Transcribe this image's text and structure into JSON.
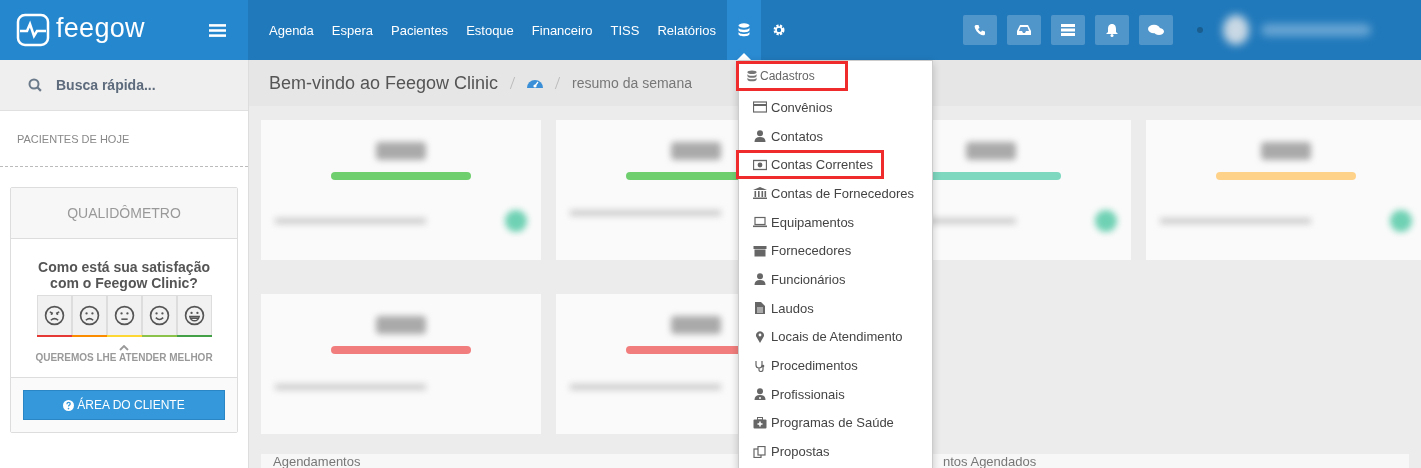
{
  "brand": {
    "name": "feegow"
  },
  "nav": [
    {
      "label": "Agenda"
    },
    {
      "label": "Espera"
    },
    {
      "label": "Pacientes"
    },
    {
      "label": "Estoque"
    },
    {
      "label": "Financeiro"
    },
    {
      "label": "TISS"
    },
    {
      "label": "Relatórios"
    }
  ],
  "sidebar": {
    "search": {
      "placeholder": "Busca rápida..."
    },
    "section": "PACIENTES DE HOJE",
    "survey": {
      "title": "QUALIDÔMETRO",
      "question": "Como está sua satisfação com o Feegow Clinic?",
      "hint": "QUEREMOS LHE ATENDER MELHOR",
      "faces": [
        {
          "kind": "angry",
          "color": "#e53935"
        },
        {
          "kind": "sad",
          "color": "#fb8c00"
        },
        {
          "kind": "neutral",
          "color": "#fdd835"
        },
        {
          "kind": "happy",
          "color": "#8bc34a"
        },
        {
          "kind": "grin",
          "color": "#43a047"
        }
      ],
      "button": "ÁREA DO CLIENTE"
    }
  },
  "breadcrumb": {
    "title": "Bem-vindo ao Feegow Clinic",
    "current": "resumo da semana"
  },
  "cards": [
    {
      "color": "#6fcf6f"
    },
    {
      "color": "#6fcf6f"
    },
    {
      "color": "#7ed8c0"
    },
    {
      "color": "#ffd28a"
    },
    {
      "color": "#f27d7d"
    },
    {
      "color": "#f27d7d"
    }
  ],
  "panels": [
    "Agendamentos",
    "ntos Agendados"
  ],
  "menu": {
    "header": {
      "label": "Cadastros",
      "highlighted": true
    },
    "items": [
      {
        "label": "Convênios",
        "highlighted": false
      },
      {
        "label": "Contatos",
        "highlighted": false
      },
      {
        "label": "Contas Correntes",
        "highlighted": true
      },
      {
        "label": "Contas de Fornecedores",
        "highlighted": false
      },
      {
        "label": "Equipamentos",
        "highlighted": false
      },
      {
        "label": "Fornecedores",
        "highlighted": false
      },
      {
        "label": "Funcionários",
        "highlighted": false
      },
      {
        "label": "Laudos",
        "highlighted": false
      },
      {
        "label": "Locais de Atendimento",
        "highlighted": false
      },
      {
        "label": "Procedimentos",
        "highlighted": false
      },
      {
        "label": "Profissionais",
        "highlighted": false
      },
      {
        "label": "Programas de Saúde",
        "highlighted": false
      },
      {
        "label": "Propostas",
        "highlighted": false
      }
    ]
  }
}
